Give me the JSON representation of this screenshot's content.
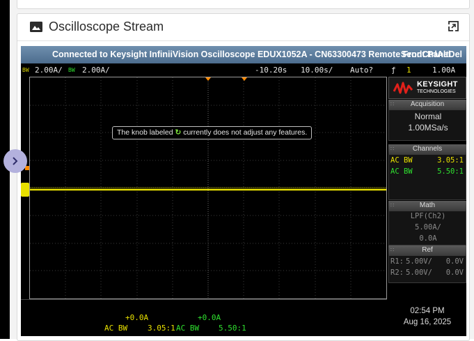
{
  "card": {
    "title": "Oscilloscope Stream"
  },
  "scope": {
    "title": "Connected to Keysight InfiniiVision Oscilloscope EDUX1052A - CN63300473 Remote Front Panel",
    "title_buttons": "SendCtrlAltDel",
    "status": {
      "ch1_bw": "BW",
      "ch1_scale": "2.00A/",
      "ch2_bw": "BW",
      "ch2_scale": "2.00A/",
      "time_offset": "-10.20s",
      "time_scale": "10.00s/",
      "trigger_mode": "Auto?",
      "trigger_slope": "ƒ",
      "trigger_source": "1",
      "trigger_level": "1.00A"
    },
    "tooltip_before": "The knob labeled",
    "tooltip_after": "currently does not adjust any features.",
    "side": {
      "logo_main": "KEYSIGHT",
      "logo_sub": "TECHNOLOGIES",
      "acquisition_title": "Acquisition",
      "acq_mode": "Normal",
      "acq_rate": "1.00MSa/s",
      "channels_title": "Channels",
      "ch1_coupling": "AC BW",
      "ch1_probe": "3.05:1",
      "ch2_coupling": "AC BW",
      "ch2_probe": "5.50:1",
      "math_title": "Math",
      "math_fn": "LPF(Ch2)",
      "math_scale": "5.00A/",
      "math_offset": "0.0A",
      "ref_title": "Ref",
      "r1_label": "R1:",
      "r1_scale": "5.00V/",
      "r1_offset": "0.0V",
      "r2_label": "R2:",
      "r2_scale": "5.00V/",
      "r2_offset": "0.0V"
    },
    "bottom": {
      "ch1_offset": "+0.0A",
      "ch1_coupling": "AC BW",
      "ch1_probe": "3.05:1",
      "ch2_offset": "+0.0A",
      "ch2_coupling": "AC BW",
      "ch2_probe": "5.50:1"
    },
    "time": "02:54 PM",
    "date": "Aug 16, 2025"
  },
  "colors": {
    "ch1": "#e8e000",
    "ch2": "#2fe02f",
    "trigger": "#ff8a00"
  }
}
